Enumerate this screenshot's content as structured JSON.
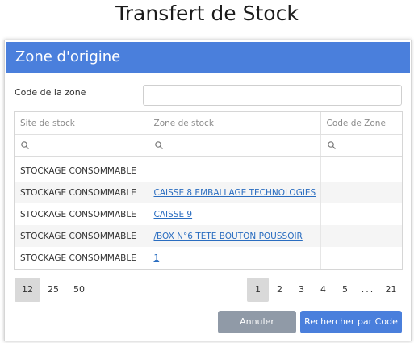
{
  "page": {
    "title": "Transfert de Stock"
  },
  "dialog": {
    "title": "Zone d'origine",
    "code_label": "Code de la zone",
    "code_value": "",
    "code_placeholder": ""
  },
  "grid": {
    "columns": [
      "Site de stock",
      "Zone de stock",
      "Code de Zone"
    ],
    "rows": [
      {
        "site": "STOCKAGE CONSOMMABLE",
        "zone": "",
        "code": ""
      },
      {
        "site": "STOCKAGE CONSOMMABLE",
        "zone": "CAISSE 8 EMBALLAGE TECHNOLOGIES",
        "code": ""
      },
      {
        "site": "STOCKAGE CONSOMMABLE",
        "zone": "CAISSE 9",
        "code": ""
      },
      {
        "site": "STOCKAGE CONSOMMABLE",
        "zone": "/BOX N°6 TETE BOUTON POUSSOIR",
        "code": ""
      },
      {
        "site": "STOCKAGE CONSOMMABLE",
        "zone": "1",
        "code": ""
      }
    ]
  },
  "pager": {
    "sizes": [
      "12",
      "25",
      "50"
    ],
    "selected_size": "12",
    "pages": [
      "1",
      "2",
      "3",
      "4",
      "5"
    ],
    "ellipsis": "...",
    "last_page": "21",
    "current_page": "1"
  },
  "buttons": {
    "cancel": "Annuler",
    "search": "Rechercher par Code"
  },
  "colors": {
    "header_bg": "#4a7fdc",
    "primary_button": "#4a7fdc",
    "secondary_button": "#909aa7",
    "link": "#2a6dc0"
  }
}
